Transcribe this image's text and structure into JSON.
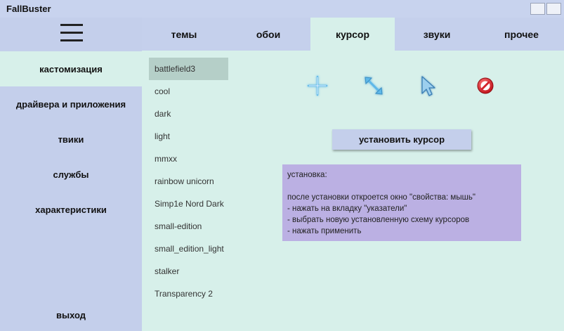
{
  "app": {
    "title": "FallBuster"
  },
  "tabs": [
    {
      "label": "темы"
    },
    {
      "label": "обои"
    },
    {
      "label": "курсор",
      "active": true
    },
    {
      "label": "звуки"
    },
    {
      "label": "прочее"
    }
  ],
  "sidebar": {
    "items": [
      {
        "label": "кастомизация",
        "active": true
      },
      {
        "label": "драйвера и приложения"
      },
      {
        "label": "твики"
      },
      {
        "label": "службы"
      },
      {
        "label": "характеристики"
      }
    ],
    "exit_label": "выход"
  },
  "cursor_schemes": [
    "battlefield3",
    "cool",
    "dark",
    "light",
    "mmxx",
    "rainbow unicorn",
    "Simp1e Nord Dark",
    "small-edition",
    "small_edition_light",
    "stalker",
    "Transparency 2"
  ],
  "selected_scheme": "battlefield3",
  "preview_icons": [
    "crosshair-cursor-icon",
    "resize-diagonal-cursor-icon",
    "arrow-pointer-cursor-icon",
    "unavailable-cursor-icon"
  ],
  "install_button": {
    "label": "установить курсор"
  },
  "instructions": {
    "heading": "установка:",
    "lines": [
      "после установки откроется окно \"свойства: мышь\"",
      "- нажать на вкладку \"указатели\"",
      "- выбрать новую установленную схему курсоров",
      "- нажать применить"
    ]
  },
  "colors": {
    "panel": "#c4cfeb",
    "active": "#d7f0ea",
    "selected": "#b5cfc8",
    "info_box": "#bbb0e3"
  }
}
